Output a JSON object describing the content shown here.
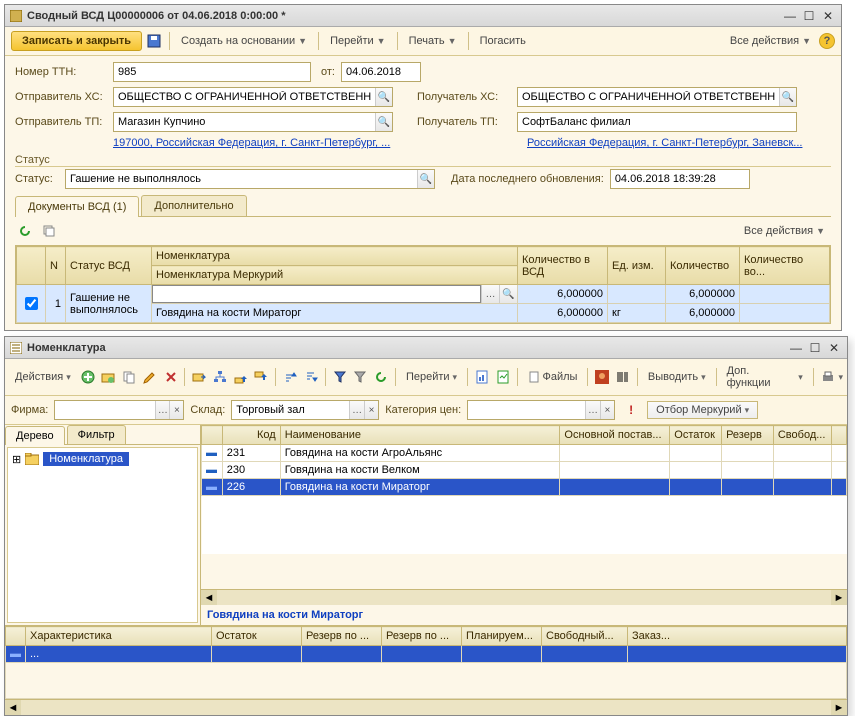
{
  "win1": {
    "title": "Сводный ВСД Ц00000006 от 04.06.2018 0:00:00 *",
    "toolbar": {
      "save_close": "Записать и закрыть",
      "create_based": "Создать на основании",
      "goto": "Перейти",
      "print": "Печать",
      "pay": "Погасить",
      "all_actions": "Все действия"
    },
    "fields": {
      "ttn_label": "Номер ТТН:",
      "ttn_value": "985",
      "ot_label": "от:",
      "ot_value": "04.06.2018",
      "sender_xc_label": "Отправитель ХС:",
      "sender_xc_value": "ОБЩЕСТВО С ОГРАНИЧЕННОЙ ОТВЕТСТВЕННОС",
      "receiver_xc_label": "Получатель ХС:",
      "receiver_xc_value": "ОБЩЕСТВО С ОГРАНИЧЕННОЙ ОТВЕТСТВЕННО(",
      "sender_tp_label": "Отправитель ТП:",
      "sender_tp_value": "Магазин Купчино",
      "receiver_tp_label": "Получатель ТП:",
      "receiver_tp_value": "СофтБаланс филиал",
      "sender_addr": "197000, Российская Федерация, г. Санкт-Петербург, ...",
      "receiver_addr": "Российская Федерация, г. Санкт-Петербург, Заневск..."
    },
    "status_section": "Статус",
    "status_label": "Статус:",
    "status_value": "Гашение не выполнялось",
    "upd_label": "Дата последнего обновления:",
    "upd_value": "04.06.2018 18:39:28",
    "tabs": {
      "docs": "Документы ВСД (1)",
      "add": "Дополнительно"
    },
    "gridbar": {
      "all_actions": "Все действия"
    },
    "grid": {
      "cols": {
        "n": "N",
        "status": "Статус ВСД",
        "nomen": "Номенклатура",
        "nomen_m": "Номенклатура Меркурий",
        "qty_vsd": "Количество в ВСД",
        "unit": "Ед. изм.",
        "qty": "Количество",
        "qty_ret": "Количество во..."
      },
      "row": {
        "n": "1",
        "status": "Гашение не выполнялось",
        "nomen": "",
        "nomen_m": "Говядина на кости Мираторг",
        "qty_vsd1": "6,000000",
        "qty_vsd2": "6,000000",
        "unit": "кг",
        "qty1": "6,000000",
        "qty2": "6,000000"
      }
    }
  },
  "win2": {
    "title": "Номенклатура",
    "toolbar": {
      "actions": "Действия",
      "goto": "Перейти",
      "files": "Файлы",
      "output": "Выводить",
      "extra": "Доп. функции"
    },
    "filter": {
      "firm_label": "Фирма:",
      "firm_value": "",
      "store_label": "Склад:",
      "store_value": "Торговый зал",
      "price_label": "Категория цен:",
      "price_value": "",
      "mercury": "Отбор Меркурий"
    },
    "treetabs": {
      "tree": "Дерево",
      "filter": "Фильтр"
    },
    "tree_root": "Номенклатура",
    "list": {
      "cols": {
        "code": "Код",
        "name": "Наименование",
        "supplier": "Основной постав...",
        "stock": "Остаток",
        "reserve": "Резерв",
        "free": "Свобод..."
      },
      "rows": [
        {
          "code": "231",
          "name": "Говядина на кости АгроАльянс"
        },
        {
          "code": "230",
          "name": "Говядина на кости Велком"
        },
        {
          "code": "226",
          "name": "Говядина на кости Мираторг"
        }
      ]
    },
    "selected_name": "Говядина на кости Мираторг",
    "chars": {
      "cols": {
        "char": "Характеристика",
        "stock": "Остаток",
        "res1": "Резерв по ...",
        "res2": "Резерв по ...",
        "plan": "Планируем...",
        "free": "Свободный...",
        "order": "Заказ..."
      },
      "row_char": "..."
    }
  }
}
